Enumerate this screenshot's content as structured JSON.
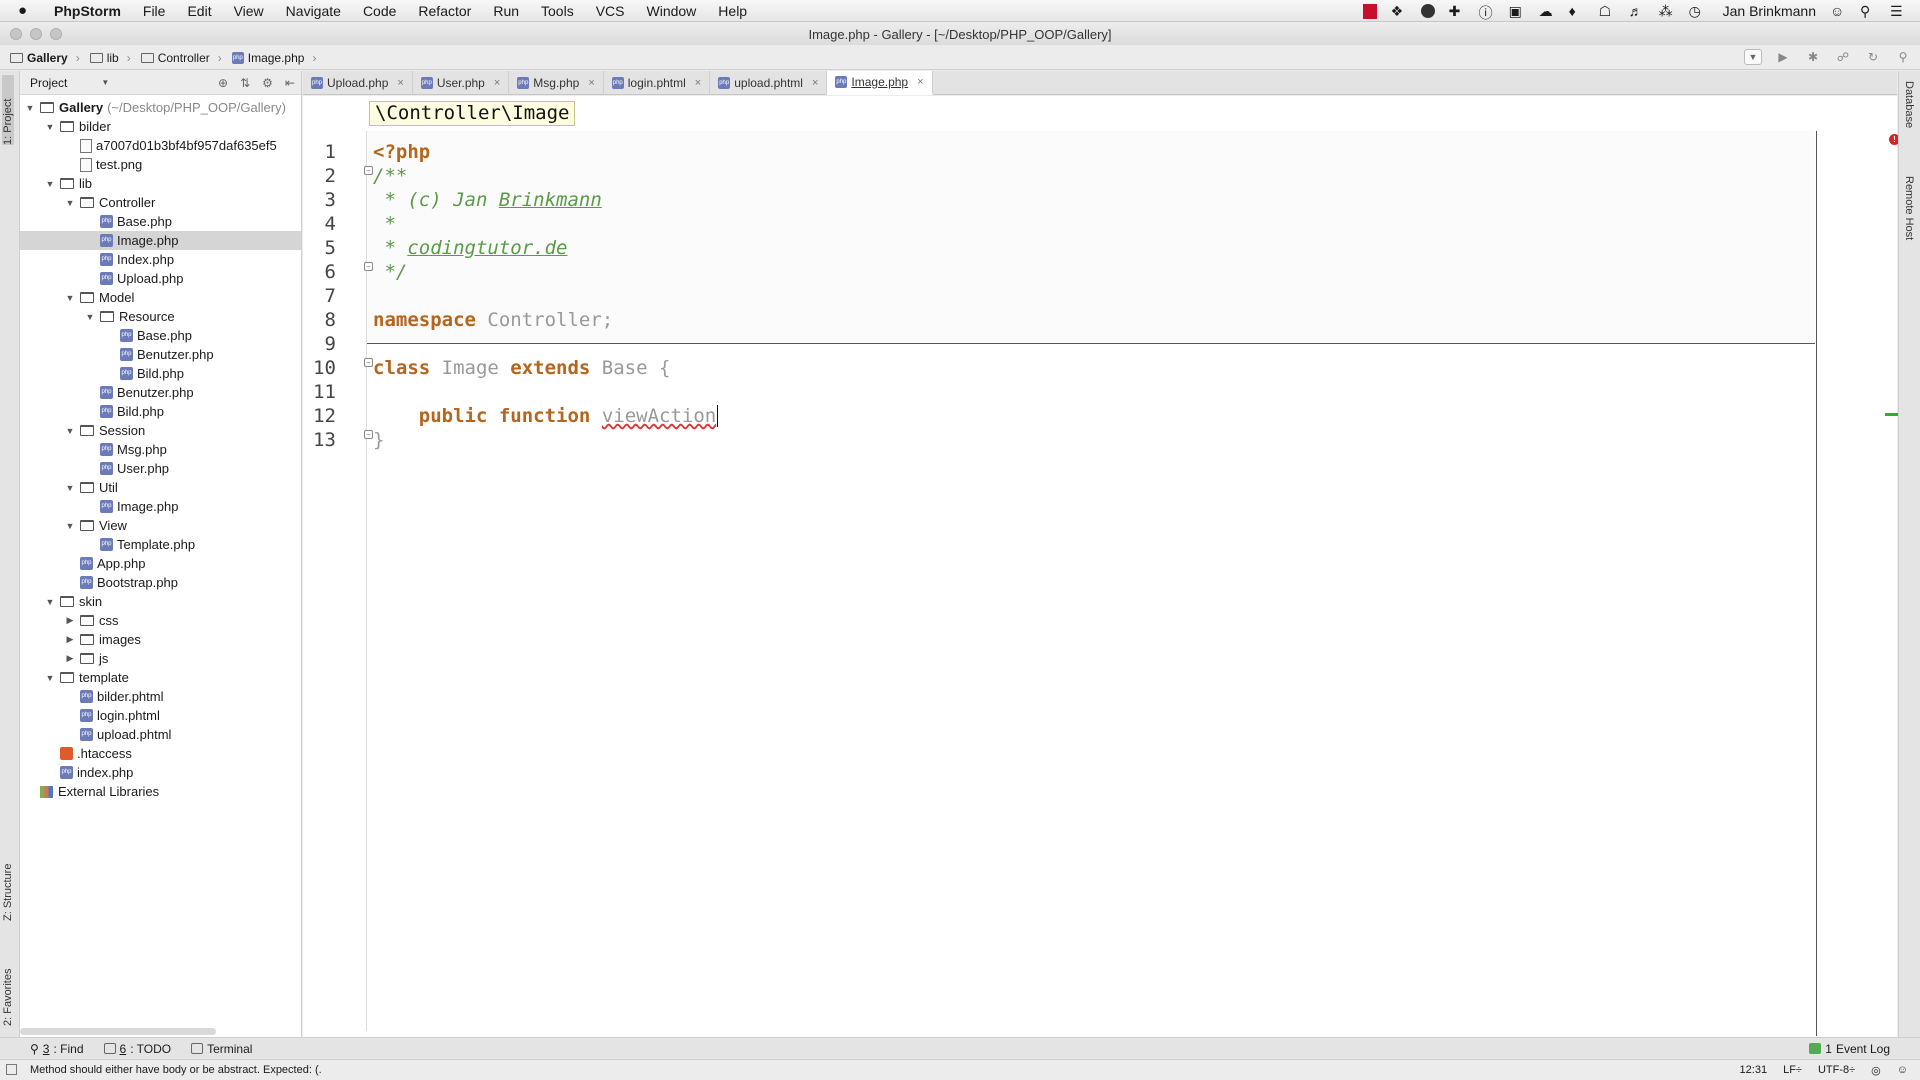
{
  "menubar": {
    "apple": "",
    "app_name": "PhpStorm",
    "items": [
      "File",
      "Edit",
      "View",
      "Navigate",
      "Code",
      "Refactor",
      "Run",
      "Tools",
      "VCS",
      "Window",
      "Help"
    ],
    "user": "Jan Brinkmann"
  },
  "window": {
    "title": "Image.php - Gallery - [~/Desktop/PHP_OOP/Gallery]"
  },
  "navbar": {
    "crumbs": [
      "Gallery",
      "lib",
      "Controller",
      "Image.php"
    ]
  },
  "left_strip": {
    "project_tab": "1: Project",
    "structure_tab": "Z: Structure",
    "favorites_tab": "2: Favorites"
  },
  "project": {
    "header": "Project",
    "root_name": "Gallery",
    "root_path": "(~/Desktop/PHP_OOP/Gallery)",
    "tree": [
      {
        "label": "bilder",
        "type": "folder",
        "depth": 1,
        "open": true
      },
      {
        "label": "a7007d01b3bf4bf957daf635ef5",
        "type": "file",
        "depth": 2
      },
      {
        "label": "test.png",
        "type": "file",
        "depth": 2
      },
      {
        "label": "lib",
        "type": "folder",
        "depth": 1,
        "open": true
      },
      {
        "label": "Controller",
        "type": "folder",
        "depth": 2,
        "open": true
      },
      {
        "label": "Base.php",
        "type": "php",
        "depth": 3
      },
      {
        "label": "Image.php",
        "type": "php",
        "depth": 3,
        "selected": true
      },
      {
        "label": "Index.php",
        "type": "php",
        "depth": 3
      },
      {
        "label": "Upload.php",
        "type": "php",
        "depth": 3
      },
      {
        "label": "Model",
        "type": "folder",
        "depth": 2,
        "open": true
      },
      {
        "label": "Resource",
        "type": "folder",
        "depth": 3,
        "open": true
      },
      {
        "label": "Base.php",
        "type": "php",
        "depth": 4
      },
      {
        "label": "Benutzer.php",
        "type": "php",
        "depth": 4
      },
      {
        "label": "Bild.php",
        "type": "php",
        "depth": 4
      },
      {
        "label": "Benutzer.php",
        "type": "php",
        "depth": 3
      },
      {
        "label": "Bild.php",
        "type": "php",
        "depth": 3
      },
      {
        "label": "Session",
        "type": "folder",
        "depth": 2,
        "open": true
      },
      {
        "label": "Msg.php",
        "type": "php",
        "depth": 3
      },
      {
        "label": "User.php",
        "type": "php",
        "depth": 3
      },
      {
        "label": "Util",
        "type": "folder",
        "depth": 2,
        "open": true
      },
      {
        "label": "Image.php",
        "type": "php",
        "depth": 3
      },
      {
        "label": "View",
        "type": "folder",
        "depth": 2,
        "open": true
      },
      {
        "label": "Template.php",
        "type": "php",
        "depth": 3
      },
      {
        "label": "App.php",
        "type": "php",
        "depth": 2
      },
      {
        "label": "Bootstrap.php",
        "type": "php",
        "depth": 2
      },
      {
        "label": "skin",
        "type": "folder",
        "depth": 1,
        "open": true
      },
      {
        "label": "css",
        "type": "folder",
        "depth": 2,
        "open": false
      },
      {
        "label": "images",
        "type": "folder",
        "depth": 2,
        "open": false
      },
      {
        "label": "js",
        "type": "folder",
        "depth": 2,
        "open": false
      },
      {
        "label": "template",
        "type": "folder",
        "depth": 1,
        "open": true
      },
      {
        "label": "bilder.phtml",
        "type": "php",
        "depth": 2
      },
      {
        "label": "login.phtml",
        "type": "php",
        "depth": 2
      },
      {
        "label": "upload.phtml",
        "type": "php",
        "depth": 2
      },
      {
        "label": ".htaccess",
        "type": "htaccess",
        "depth": 1
      },
      {
        "label": "index.php",
        "type": "php",
        "depth": 1
      },
      {
        "label": "External Libraries",
        "type": "lib",
        "depth": 0
      }
    ]
  },
  "tabs": [
    {
      "label": "Upload.php",
      "active": false
    },
    {
      "label": "User.php",
      "active": false
    },
    {
      "label": "Msg.php",
      "active": false
    },
    {
      "label": "login.phtml",
      "active": false
    },
    {
      "label": "upload.phtml",
      "active": false
    },
    {
      "label": "Image.php",
      "active": true
    }
  ],
  "editor": {
    "namespace_hint": "\\Controller\\Image",
    "line_numbers": [
      "1",
      "2",
      "3",
      "4",
      "5",
      "6",
      "7",
      "8",
      "9",
      "10",
      "11",
      "12",
      "13"
    ],
    "code": {
      "l1": "<?php",
      "l2": "/**",
      "l3_star": " * ",
      "l3_text": "(c) Jan ",
      "l3_name": "Brinkmann",
      "l4": " *",
      "l5_star": " * ",
      "l5_link": "codingtutor.de",
      "l6": " */",
      "l8_kw": "namespace",
      "l8_rest": " Controller;",
      "l10_kw1": "class",
      "l10_name": " Image ",
      "l10_kw2": "extends",
      "l10_rest": " Base {",
      "l12_indent": "    ",
      "l12_kw": "public function",
      "l12_space": " ",
      "l12_name": "viewAction",
      "l13": "}"
    }
  },
  "right_strip": {
    "database": "Database",
    "remote_host": "Remote Host"
  },
  "bottom_bar": {
    "find_num": "3",
    "find_label": ": Find",
    "todo_num": "6",
    "todo_label": ": TODO",
    "terminal": "Terminal",
    "event_log": "Event Log",
    "event_count": "1"
  },
  "status": {
    "message": "Method should either have body or be abstract. Expected: (.",
    "position": "12:31",
    "line_sep": "LF÷",
    "encoding": "UTF-8÷"
  }
}
